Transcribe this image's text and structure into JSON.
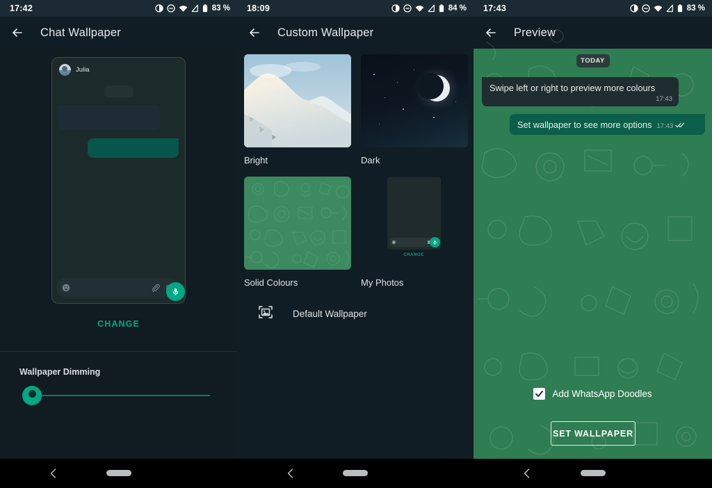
{
  "panels": {
    "left": {
      "status": {
        "time": "17:42",
        "battery": "83 %"
      },
      "appbar": {
        "title": "Chat Wallpaper",
        "back_icon": "arrow-left-icon"
      },
      "preview": {
        "contact_name": "Julia",
        "input_icons": [
          "emoji-icon",
          "attach-icon",
          "camera-icon",
          "mic-icon"
        ]
      },
      "change_label": "CHANGE",
      "dimming": {
        "label": "Wallpaper Dimming",
        "value": 0,
        "thumb_icon": "brightness-moon-icon"
      }
    },
    "middle": {
      "status": {
        "time": "18:09",
        "battery": "84 %"
      },
      "appbar": {
        "title": "Custom Wallpaper",
        "back_icon": "arrow-left-icon"
      },
      "options": [
        {
          "label": "Bright",
          "kind": "mountain-photo"
        },
        {
          "label": "Dark",
          "kind": "night-moon-photo"
        },
        {
          "label": "Solid Colours",
          "kind": "green-doodle"
        },
        {
          "label": "My Photos",
          "kind": "chat-mockup",
          "sub_label": "CHANGE"
        }
      ],
      "default_wallpaper": {
        "label": "Default Wallpaper",
        "icon": "image-picture-icon"
      }
    },
    "right": {
      "status": {
        "time": "17:43",
        "battery": "83 %"
      },
      "appbar": {
        "title": "Preview",
        "back_icon": "arrow-left-icon"
      },
      "chat": {
        "date_chip": "TODAY",
        "messages": [
          {
            "direction": "incoming",
            "text": "Swipe left or right to preview more colours",
            "time": "17:43",
            "ticks": false
          },
          {
            "direction": "outgoing",
            "text": "Set wallpaper to see more options",
            "time": "17:43",
            "ticks": true
          }
        ]
      },
      "doodles_checkbox": {
        "label": "Add WhatsApp Doodles",
        "checked": true
      },
      "set_wallpaper_label": "SET WALLPAPER"
    }
  },
  "navbar": {
    "back_icon": "chevron-left-icon",
    "home_pill": "home-pill-indicator"
  },
  "colors": {
    "accent_teal": "#00a884",
    "dark_bg": "#111d24",
    "green_wallpaper": "#2f7d52",
    "bubble_out": "#0b5e4a",
    "bubble_in": "#1f2c30"
  }
}
